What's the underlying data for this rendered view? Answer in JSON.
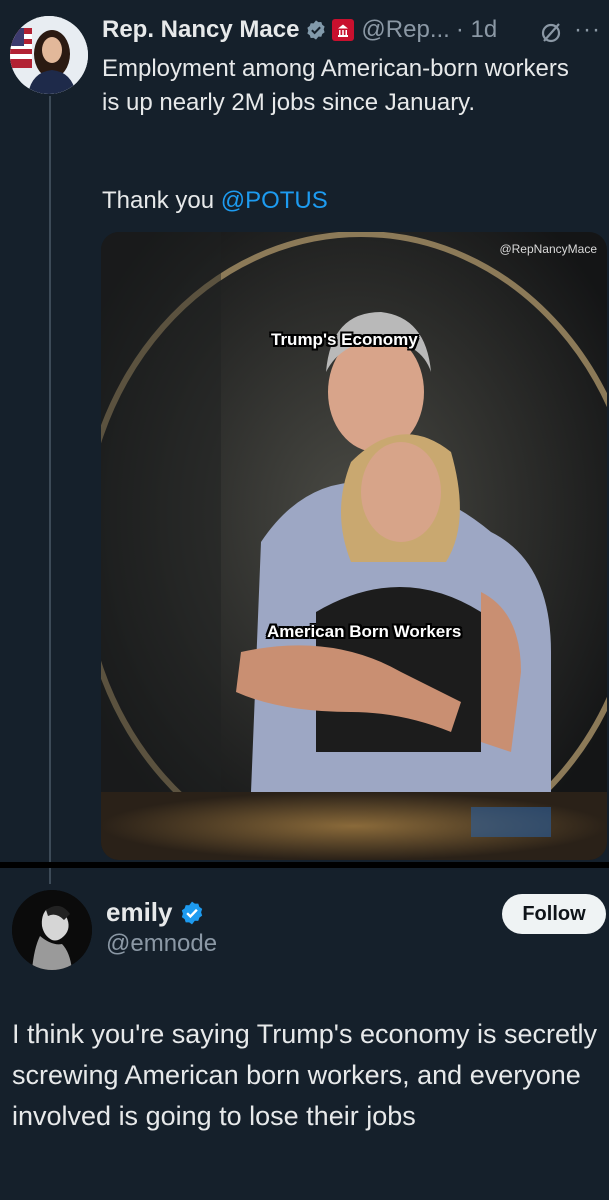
{
  "tweet1": {
    "author_name": "Rep. Nancy Mace",
    "handle": "@Rep...",
    "timestamp": "· 1d",
    "more_label": "···",
    "body": "Employment among American-born workers is up nearly 2M jobs since January.",
    "thanks": "Thank you ",
    "mention": "@POTUS",
    "media": {
      "watermark": "@RepNancyMace",
      "caption_top": "Trump's Economy",
      "caption_bottom": "American Born Workers"
    }
  },
  "reply": {
    "author_name": "emily",
    "handle": "@emnode",
    "follow_label": "Follow",
    "body": "I think you're saying Trump's economy is secretly screwing American born workers, and everyone involved is going to lose their jobs"
  },
  "colors": {
    "background": "#15202b",
    "link": "#1d9bf0",
    "verified_blue": "#1d9bf0",
    "verified_gray": "#829aab",
    "gov_badge": "#c8102e",
    "secondary_text": "#8b98a5"
  },
  "icons": [
    "verified-gray-icon",
    "government-badge-icon",
    "grok-icon",
    "more-icon",
    "verified-blue-icon"
  ]
}
